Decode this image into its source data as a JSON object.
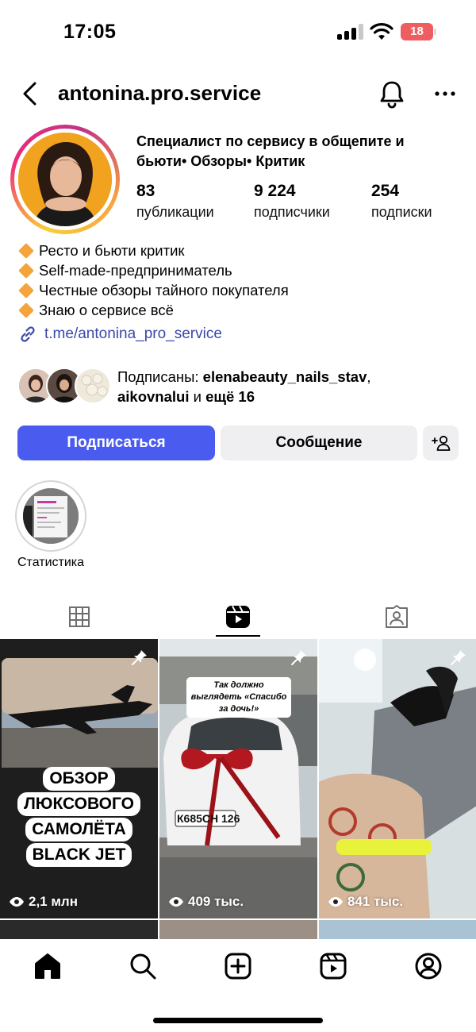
{
  "status_bar": {
    "time": "17:05",
    "battery": "18"
  },
  "header": {
    "username": "antonina.pro.service"
  },
  "profile": {
    "category": "Специалист по сервису в общепите и бьюти• Обзоры• Критик",
    "stats": [
      {
        "value": "83",
        "label": "публикации"
      },
      {
        "value": "9 224",
        "label": "подписчики"
      },
      {
        "value": "254",
        "label": "подписки"
      }
    ],
    "bio": [
      "Ресто и бьюти критик",
      "Self-made-предприниматель",
      "Честные обзоры тайного покупателя",
      "Знаю о сервисе всё"
    ],
    "link": "t.me/antonina_pro_service",
    "followed_by": {
      "prefix": "Подписаны: ",
      "user1": "elenabeauty_nails_stav",
      "sep": ",",
      "user2": "aikovnalui",
      "middle": " и ",
      "more": "ещё 16"
    }
  },
  "buttons": {
    "follow": "Подписаться",
    "message": "Сообщение",
    "add_user": "+person"
  },
  "highlights": [
    {
      "label": "Статистика"
    }
  ],
  "tabs": [
    {
      "name": "grid",
      "icon": "grid-icon",
      "active": false
    },
    {
      "name": "reels",
      "icon": "reels-icon",
      "active": true
    },
    {
      "name": "tagged",
      "icon": "tagged-icon",
      "active": false
    }
  ],
  "grid": [
    {
      "views": "2,1 млн",
      "pinned": true,
      "overlay": [
        "ОБЗОР",
        "ЛЮКСОВОГО",
        "САМОЛЁТА",
        "BLACK JET"
      ]
    },
    {
      "views": "409 тыс.",
      "pinned": true,
      "caption": "Так должно выглядеть «Спасибо за дочь!»",
      "plate": "К685СН 126"
    },
    {
      "views": "841 тыс.",
      "pinned": true
    }
  ],
  "bottom_nav": [
    "home-icon",
    "search-icon",
    "create-icon",
    "reels-icon",
    "profile-icon"
  ],
  "colors": {
    "accent": "#4a5cf0",
    "link": "#3b48a8",
    "battery": "#ee5e60"
  }
}
